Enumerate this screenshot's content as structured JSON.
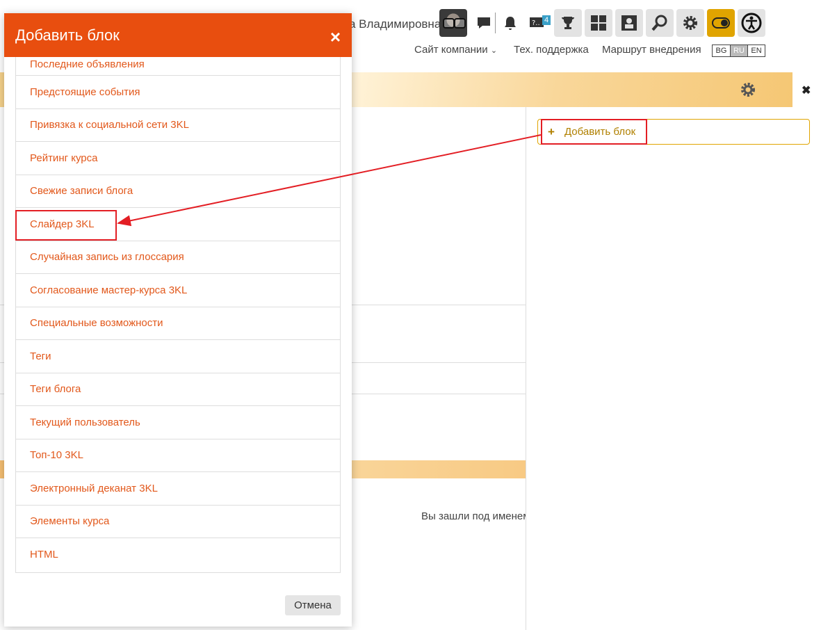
{
  "topbar": {
    "user_name": "а Владимировна",
    "badge_count": "4",
    "icons": [
      "chat-icon",
      "bell-icon",
      "help-icon",
      "trophy-icon",
      "grid-icon",
      "puzzle-icon",
      "search-icon",
      "gear-icon",
      "toggle-icon",
      "accessibility-icon"
    ],
    "nav": [
      {
        "label": "Сайт компании"
      },
      {
        "label": "Тех. поддержка"
      },
      {
        "label": "Маршрут внедрения"
      }
    ],
    "languages": [
      "BG",
      "RU",
      "EN"
    ],
    "active_language": "RU"
  },
  "right_panel": {
    "add_block_label": "Добавить блок"
  },
  "footer": {
    "logged_in_text": "Вы зашли под именем"
  },
  "modal": {
    "title": "Добавить блок",
    "close_symbol": "×",
    "items": [
      {
        "label": "Последние объявления"
      },
      {
        "label": "Предстоящие события"
      },
      {
        "label": "Привязка к социальной сети 3KL"
      },
      {
        "label": "Рейтинг курса"
      },
      {
        "label": "Свежие записи блога"
      },
      {
        "label": "Слайдер 3KL"
      },
      {
        "label": "Случайная запись из глоссария"
      },
      {
        "label": "Согласование мастер-курса 3KL"
      },
      {
        "label": "Специальные возможности"
      },
      {
        "label": "Теги"
      },
      {
        "label": "Теги блога"
      },
      {
        "label": "Текущий пользователь"
      },
      {
        "label": "Топ-10 3KL"
      },
      {
        "label": "Электронный деканат 3KL"
      },
      {
        "label": "Элементы курса"
      },
      {
        "label": "HTML"
      }
    ],
    "cancel_label": "Отмена"
  },
  "colors": {
    "accent": "#e84e0f",
    "link": "#e2581b",
    "annotation": "#e31e24",
    "gold": "#e0a400"
  }
}
